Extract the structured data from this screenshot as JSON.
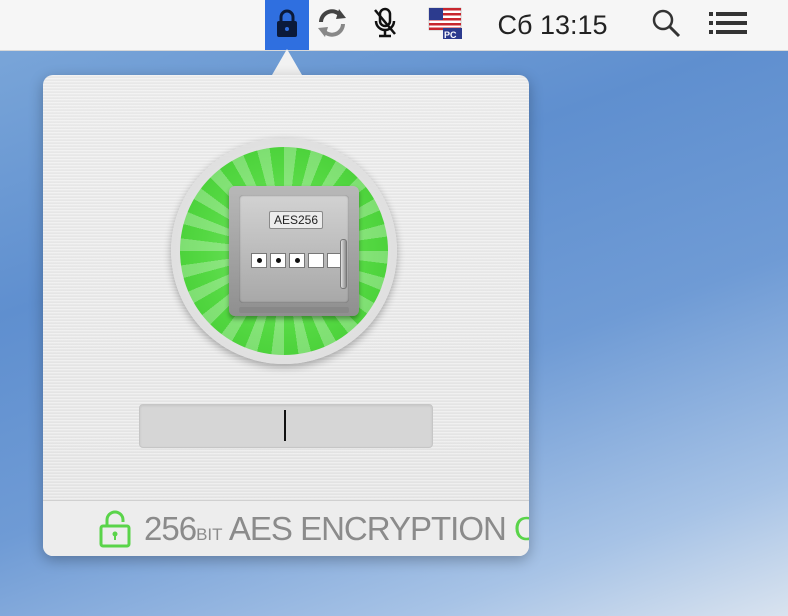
{
  "menubar": {
    "clock": "Сб 13:15",
    "flag_label": "PC",
    "icons": [
      "lock-icon",
      "sync-icon",
      "mic-muted-icon",
      "us-flag-icon",
      "search-icon",
      "list-icon"
    ],
    "active_color": "#2f6fe0"
  },
  "popover": {
    "safe_label": "AES256",
    "keypad": [
      "filled",
      "filled",
      "filled",
      "empty",
      "empty"
    ],
    "password_value": "",
    "footer": {
      "size": "256",
      "unit": "BIT",
      "encryption": "AES ENCRYPTION",
      "status": "ON"
    },
    "colors": {
      "badge_green": "#54d842",
      "status_on": "#5ad44a"
    }
  }
}
